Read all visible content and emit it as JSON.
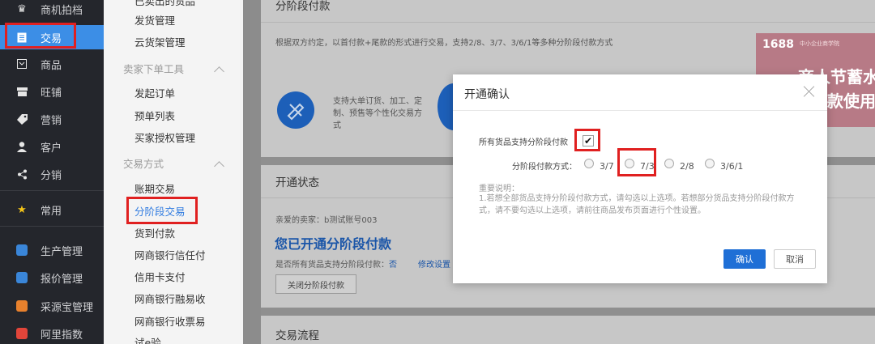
{
  "nav": {
    "items": [
      {
        "label": "商机拍档",
        "icon": "crown-icon"
      },
      {
        "label": "交易",
        "icon": "document-icon"
      },
      {
        "label": "商品",
        "icon": "box-icon"
      },
      {
        "label": "旺铺",
        "icon": "store-icon"
      },
      {
        "label": "营销",
        "icon": "tag-icon"
      },
      {
        "label": "客户",
        "icon": "user-icon"
      },
      {
        "label": "分销",
        "icon": "share-icon"
      },
      {
        "label": "常用",
        "icon": "star-icon"
      },
      {
        "label": "生产管理",
        "icon": "production-app-icon"
      },
      {
        "label": "报价管理",
        "icon": "quote-app-icon"
      },
      {
        "label": "采源宝管理",
        "icon": "sourcing-app-icon"
      },
      {
        "label": "阿里指数",
        "icon": "chart-app-icon"
      }
    ],
    "app_colors": [
      "#3a86d9",
      "#3a86d9",
      "#e8812d",
      "#e2453a"
    ],
    "accent": "#3c8ee6"
  },
  "submenu": {
    "items": [
      "已卖出的货品",
      "发货管理",
      "云货架管理",
      "卖家下单工具",
      "发起订单",
      "预单列表",
      "买家授权管理",
      "交易方式",
      "账期交易",
      "分阶段交易",
      "货到付款",
      "网商银行信任付",
      "信用卡支付",
      "网商银行融易收",
      "网商银行收票易",
      "试e验"
    ]
  },
  "content": {
    "section1_title": "分阶段付款",
    "section1_desc": "根据双方约定，以首付款+尾款的形式进行交易，支持2/8、3/7、3/6/1等多种分阶段付款方式",
    "feature_text": "支持大单订货、加工、定制、预售等个性化交易方式",
    "banner_badge": "1688",
    "banner_sub": "中小企业商学院",
    "banner_line1": "商人节蓄水必",
    "banner_line2": "款使用实",
    "section2_title": "开通状态",
    "greeting": "亲爱的卖家：b测试账号003",
    "opened_title": "您已开通分阶段付款",
    "all_goods_label": "是否所有货品支持分阶段付款：",
    "all_goods_value": "否",
    "modify_label": "修改设置",
    "close_button": "关闭分阶段付款",
    "section3_title": "交易流程"
  },
  "modal": {
    "title": "开通确认",
    "all_goods_label": "所有货品支持分阶段付款",
    "all_goods_checked": true,
    "method_label": "分阶段付款方式：",
    "options": [
      "3/7",
      "7/3",
      "2/8",
      "3/6/1"
    ],
    "note_title": "重要说明：",
    "note_text": "1.若想全部货品支持分阶段付款方式，请勾选以上选项。若想部分货品支持分阶段付款方式，请不要勾选以上选项，请前往商品发布页面进行个性设置。",
    "confirm": "确认",
    "cancel": "取消",
    "primary_color": "#1f6fd6"
  },
  "highlight_color": "#e02020"
}
